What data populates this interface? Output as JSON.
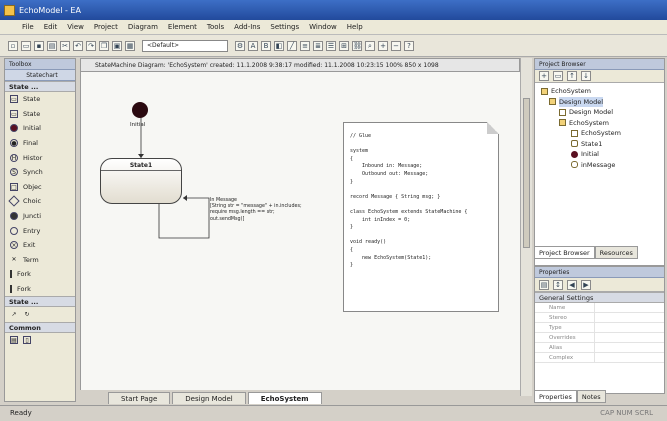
{
  "window": {
    "title": "EchoModel - EA"
  },
  "menu": [
    "File",
    "Edit",
    "View",
    "Project",
    "Diagram",
    "Element",
    "Tools",
    "Add-Ins",
    "Settings",
    "Window",
    "Help"
  ],
  "toolbar": {
    "combo_value": "<Default>"
  },
  "toolbox": {
    "header": "Toolbox",
    "subheader": "Statechart",
    "group_state": "State ...",
    "items": [
      "State",
      "State",
      "Initial",
      "Final",
      "Histor",
      "Synch",
      "Objec",
      "Choic",
      "Juncti",
      "Entry",
      "Exit",
      "Term",
      "Fork",
      "Fork"
    ],
    "group_state2": "State ...",
    "group_common": "Common"
  },
  "diagram": {
    "tab_text": "StateMachine Diagram: 'EchoSystem'   created: 11.1.2008 9:38:17   modified: 11.1.2008 10:23:15   100%   850 x 1098",
    "initial_label": "Initial",
    "state_name": "State1",
    "transition_text": "In Message\n[String str = \"message\" + in.includes;\nrequire msg.length == str;\nout.sendMsg(]",
    "note_code": "// Glue\n\nsystem\n{\n    Inbound in: Message;\n    Outbound out: Message;\n}\n\nrecord Message { String msg; }\n\nclass EchoSystem extends StateMachine {\n    int inIndex = 0;\n}\n\nvoid ready()\n{\n    new EchoSystem(State1);\n}"
  },
  "doc_tabs": [
    "Start Page",
    "Design Model",
    "EchoSystem"
  ],
  "project_browser": {
    "title": "Project Browser",
    "tree": [
      {
        "label": "EchoSystem",
        "indent": 0
      },
      {
        "label": "Design Model",
        "indent": 1
      },
      {
        "label": "Design Model",
        "indent": 2
      },
      {
        "label": "EchoSystem",
        "indent": 2
      },
      {
        "label": "EchoSystem",
        "indent": 3
      },
      {
        "label": "State1",
        "indent": 3
      },
      {
        "label": "Initial",
        "indent": 3
      },
      {
        "label": "inMessage",
        "indent": 3
      }
    ],
    "tabs": [
      "Project Browser",
      "Resources"
    ]
  },
  "properties": {
    "title": "Properties",
    "section": "General Settings",
    "rows": [
      "Name",
      "Stereo",
      "Type",
      "Overrides",
      "Alias",
      "Complex"
    ],
    "tabs": [
      "Properties",
      "Notes"
    ]
  },
  "status": {
    "left": "Ready",
    "right": "CAP NUM SCRL"
  }
}
